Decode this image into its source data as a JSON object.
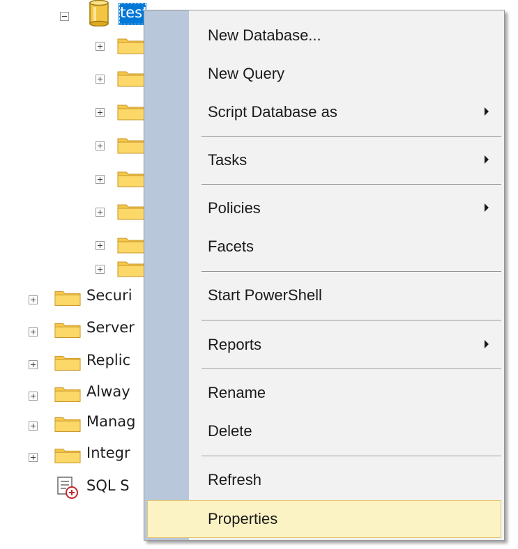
{
  "tree": {
    "root": {
      "label": "test",
      "expander": "collapse",
      "icon": "database-icon"
    },
    "child_folders": [
      "",
      "",
      "",
      "",
      "",
      "",
      "",
      ""
    ],
    "server_nodes": [
      {
        "label": "Securi",
        "icon": "folder-icon"
      },
      {
        "label": "Server",
        "icon": "folder-icon"
      },
      {
        "label": "Replic",
        "icon": "folder-icon"
      },
      {
        "label": "Alway",
        "icon": "folder-icon"
      },
      {
        "label": "Manag",
        "icon": "folder-icon"
      },
      {
        "label": "Integr",
        "icon": "folder-icon"
      }
    ],
    "last_node": {
      "label": "SQL S",
      "icon": "sql-agent-icon"
    }
  },
  "context_menu": {
    "items": [
      {
        "label": "New Database...",
        "submenu": false
      },
      {
        "label": "New Query",
        "submenu": false
      },
      {
        "label": "Script Database as",
        "submenu": true
      },
      {
        "label": "Tasks",
        "submenu": true
      },
      {
        "label": "Policies",
        "submenu": true
      },
      {
        "label": "Facets",
        "submenu": false
      },
      {
        "label": "Start PowerShell",
        "submenu": false
      },
      {
        "label": "Reports",
        "submenu": true
      },
      {
        "label": "Rename",
        "submenu": false
      },
      {
        "label": "Delete",
        "submenu": false
      },
      {
        "label": "Refresh",
        "submenu": false
      },
      {
        "label": "Properties",
        "submenu": false,
        "highlighted": true
      }
    ]
  },
  "colors": {
    "selection": "#0078d7",
    "menu_background": "#f2f2f2",
    "menu_gutter": "#b9c7da",
    "highlight_fill": "#fcf3c4",
    "highlight_border": "#e6c66a",
    "folder": "#f5c84a"
  }
}
